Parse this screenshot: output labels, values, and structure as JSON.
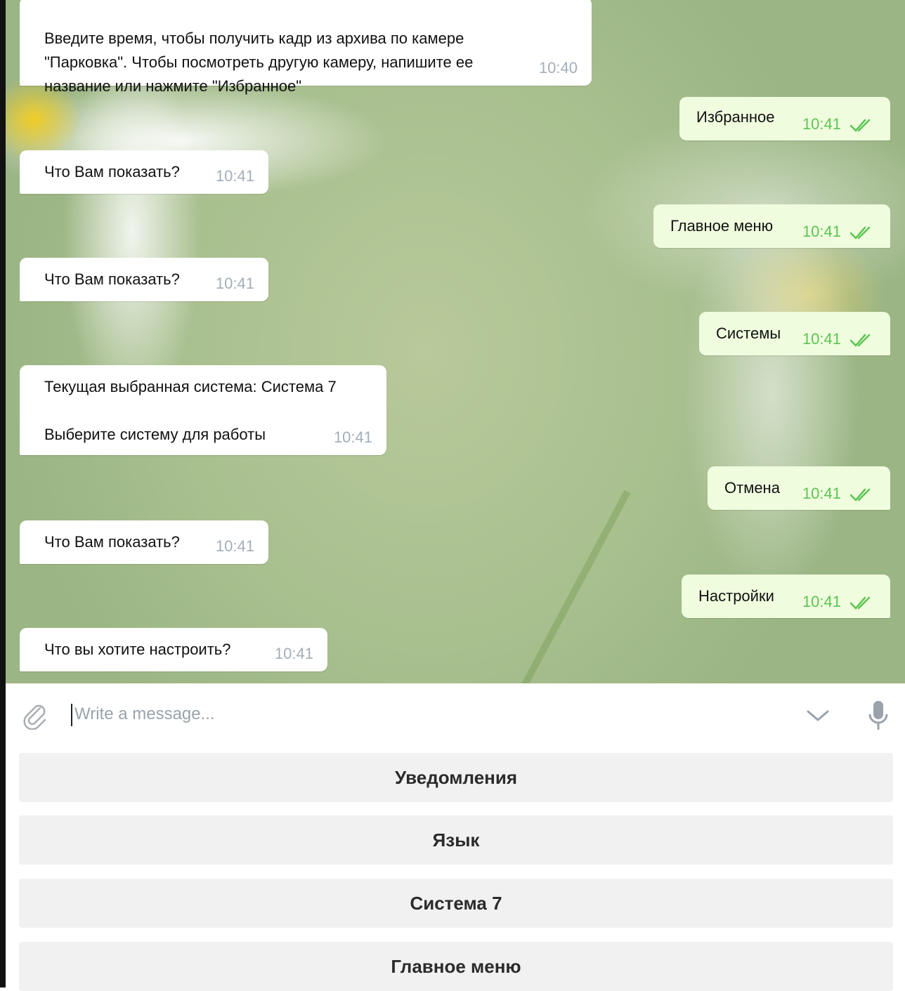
{
  "messages": [
    {
      "dir": "in",
      "text": "Введите время, чтобы получить кадр из архива по камере\n\"Парковка\". Чтобы посмотреть другую камеру, напишите ее\nназвание или нажмите \"Избранное\"",
      "time": "10:40"
    },
    {
      "dir": "out",
      "text": "Избранное",
      "time": "10:41"
    },
    {
      "dir": "in",
      "text": "Что Вам показать?",
      "time": "10:41"
    },
    {
      "dir": "out",
      "text": "Главное меню",
      "time": "10:41"
    },
    {
      "dir": "in",
      "text": "Что Вам показать?",
      "time": "10:41"
    },
    {
      "dir": "out",
      "text": "Системы",
      "time": "10:41"
    },
    {
      "dir": "in",
      "text": "Текущая выбранная система: Система 7\n\nВыберите систему для работы",
      "time": "10:41"
    },
    {
      "dir": "out",
      "text": "Отмена",
      "time": "10:41"
    },
    {
      "dir": "in",
      "text": "Что Вам показать?",
      "time": "10:41"
    },
    {
      "dir": "out",
      "text": "Настройки",
      "time": "10:41"
    },
    {
      "dir": "in",
      "text": "Что вы хотите настроить?",
      "time": "10:41"
    }
  ],
  "input": {
    "placeholder": "Write a message..."
  },
  "keyboard": [
    "Уведомления",
    "Язык",
    "Система 7",
    "Главное меню"
  ],
  "icons": {
    "attach": "paperclip-icon",
    "collapse": "chevron-down-icon",
    "voice": "microphone-icon",
    "read": "double-check-icon"
  },
  "colors": {
    "incoming": "#ffffff",
    "outgoing": "#effdde",
    "read_check": "#5dc452",
    "keyboard_button": "#f1f1f1"
  }
}
